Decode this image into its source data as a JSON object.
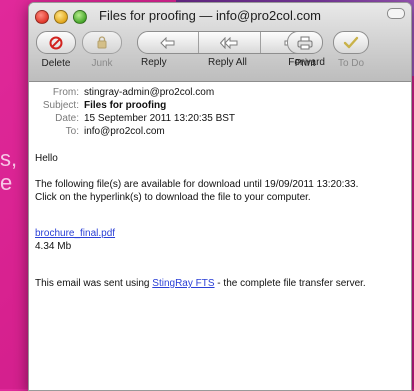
{
  "background": {
    "text_lines": [
      "s,",
      "e"
    ],
    "accent": "#e0299a"
  },
  "window": {
    "title": "Files for proofing — info@pro2col.com"
  },
  "toolbar": {
    "delete_label": "Delete",
    "junk_label": "Junk",
    "reply_label": "Reply",
    "reply_all_label": "Reply All",
    "forward_label": "Forward",
    "print_label": "Print",
    "todo_label": "To Do"
  },
  "headers": {
    "from_key": "From:",
    "from_value": "stingray-admin@pro2col.com",
    "subject_key": "Subject:",
    "subject_value": "Files for proofing",
    "date_key": "Date:",
    "date_value": "15 September 2011 13:20:35 BST",
    "to_key": "To:",
    "to_value": "info@pro2col.com"
  },
  "message": {
    "greeting": "Hello",
    "line1": "The following file(s) are available for download until 19/09/2011 13:20:33.",
    "line2": "Click on the hyperlink(s) to download the file to your computer.",
    "file_link": "brochure_final.pdf",
    "file_size": "4.34 Mb",
    "footer_before": "This email was sent using ",
    "footer_link": "StingRay FTS",
    "footer_after": " - the complete file transfer server."
  }
}
